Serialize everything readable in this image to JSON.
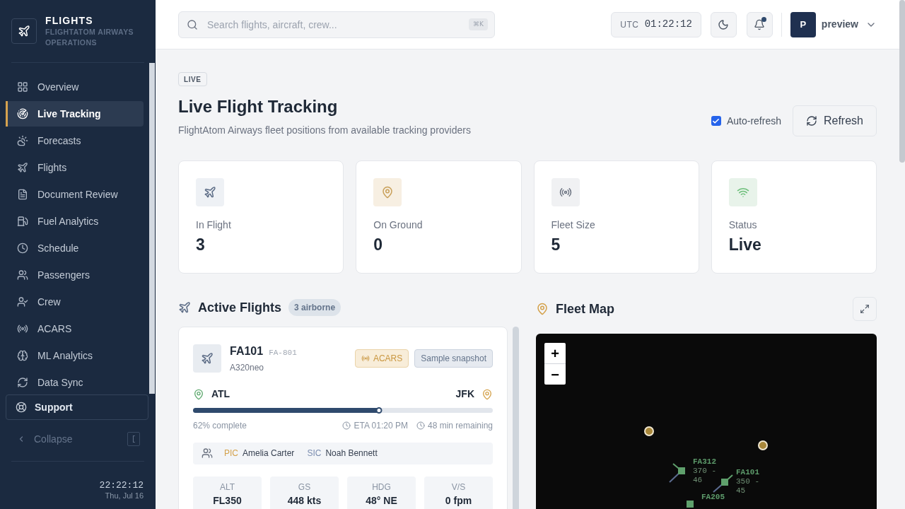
{
  "sidebar": {
    "brand": {
      "title": "FLIGHTS",
      "subtitle": "FLIGHTATOM AIRWAYS OPERATIONS"
    },
    "items": [
      {
        "label": "Overview",
        "selected": false
      },
      {
        "label": "Live Tracking",
        "selected": true
      },
      {
        "label": "Forecasts",
        "selected": false
      },
      {
        "label": "Flights",
        "selected": false
      },
      {
        "label": "Document Review",
        "selected": false
      },
      {
        "label": "Fuel Analytics",
        "selected": false
      },
      {
        "label": "Schedule",
        "selected": false
      },
      {
        "label": "Passengers",
        "selected": false
      },
      {
        "label": "Crew",
        "selected": false
      },
      {
        "label": "ACARS",
        "selected": false
      },
      {
        "label": "ML Analytics",
        "selected": false
      },
      {
        "label": "Data Sync",
        "selected": false
      }
    ],
    "support": "Support",
    "collapse": {
      "label": "Collapse",
      "shortcut": "["
    },
    "clock": {
      "time": "22:22:12",
      "date": "Thu, Jul 16"
    }
  },
  "header": {
    "search": {
      "placeholder": "Search flights, aircraft, crew...",
      "shortcut": "⌘K"
    },
    "utc": {
      "label": "UTC",
      "time": "01:22:12"
    },
    "notifications": {
      "unread": true
    },
    "user": {
      "initial": "P",
      "name": "preview"
    }
  },
  "page": {
    "badge": "LIVE",
    "title": "Live Flight Tracking",
    "subtitle": "FlightAtom Airways fleet positions from available tracking providers",
    "auto_refresh": {
      "label": "Auto-refresh",
      "checked": true
    },
    "refresh_button": "Refresh"
  },
  "stats": [
    {
      "label": "In Flight",
      "value": "3"
    },
    {
      "label": "On Ground",
      "value": "0"
    },
    {
      "label": "Fleet Size",
      "value": "5"
    },
    {
      "label": "Status",
      "value": "Live"
    }
  ],
  "active_flights": {
    "title": "Active Flights",
    "badge": "3 airborne",
    "flights": [
      {
        "flight": "FA101",
        "registration": "FA-801",
        "aircraft": "A320neo",
        "badges": [
          {
            "kind": "acars",
            "label": "ACARS"
          },
          {
            "kind": "sample",
            "label": "Sample snapshot"
          }
        ],
        "origin": "ATL",
        "destination": "JFK",
        "progress": {
          "level": 0.62,
          "label": "62% complete"
        },
        "eta": "ETA 01:20 PM",
        "remaining": "48 min remaining",
        "crew": [
          {
            "role": "PIC",
            "name": "Amelia Carter",
            "color": "#d4a24c"
          },
          {
            "role": "SIC",
            "name": "Noah Bennett",
            "color": "#7b8db0"
          }
        ],
        "metrics": [
          {
            "label": "ALT",
            "value": "FL350"
          },
          {
            "label": "GS",
            "value": "448 kts"
          },
          {
            "label": "HDG",
            "value": "48° NE"
          },
          {
            "label": "V/S",
            "value": "0 fpm"
          }
        ]
      }
    ]
  },
  "fleet_map": {
    "title": "Fleet Map",
    "zoom_in": "+",
    "zoom_out": "−",
    "aircraft": [
      {
        "callsign": "FA312",
        "detail": "370 - 46"
      },
      {
        "callsign": "FA101",
        "detail": "350 - 45"
      },
      {
        "callsign": "FA205"
      }
    ]
  }
}
